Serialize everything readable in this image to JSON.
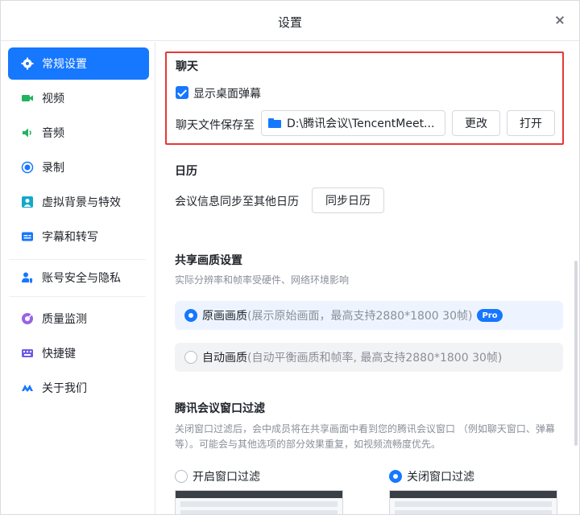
{
  "window": {
    "title": "设置"
  },
  "sidebar": {
    "items": [
      {
        "label": "常规设置",
        "icon": "gear-icon",
        "active": true
      },
      {
        "label": "视频",
        "icon": "camera-icon"
      },
      {
        "label": "音频",
        "icon": "speaker-icon"
      },
      {
        "label": "录制",
        "icon": "record-icon"
      },
      {
        "label": "虚拟背景与特效",
        "icon": "person-background-icon"
      },
      {
        "label": "字幕和转写",
        "icon": "caption-icon"
      },
      {
        "label": "账号安全与隐私",
        "icon": "user-shield-icon"
      },
      {
        "label": "质量监测",
        "icon": "monitor-icon"
      },
      {
        "label": "快捷键",
        "icon": "keyboard-icon"
      },
      {
        "label": "关于我们",
        "icon": "tencent-meeting-logo-icon"
      }
    ]
  },
  "chat": {
    "heading": "聊天",
    "show_danmaku_label": "显示桌面弹幕",
    "show_danmaku_checked": true,
    "save_path_label": "聊天文件保存至",
    "save_path_value": "D:\\腾讯会议\\TencentMeet...",
    "change_label": "更改",
    "open_label": "打开"
  },
  "calendar": {
    "heading": "日历",
    "sync_label": "会议信息同步至其他日历",
    "sync_button": "同步日历"
  },
  "share_quality": {
    "heading": "共享画质设置",
    "subtitle": "实际分辨率和帧率受硬件、网络环境影响",
    "options": [
      {
        "label": "原画画质",
        "desc": "(展示原始画面，最高支持2880*1800 30帧)",
        "badge": "Pro",
        "selected": true
      },
      {
        "label": "自动画质",
        "desc": "(自动平衡画质和帧率, 最高支持2880*1800 30帧)",
        "selected": false
      }
    ]
  },
  "window_filter": {
    "heading": "腾讯会议窗口过滤",
    "desc_line1": "关闭窗口过滤后，会中成员将在共享画面中看到您的腾讯会议窗口 （例如聊天窗口、弹幕",
    "desc_line2": "等）。可能会与其他选项的部分效果重复，如视频流畅度优先。",
    "option_on": "开启窗口过滤",
    "option_off": "关闭窗口过滤",
    "selected": "off"
  },
  "colors": {
    "accent": "#1677ff",
    "highlight": "#e53935",
    "muted_text": "#8a8f99"
  }
}
